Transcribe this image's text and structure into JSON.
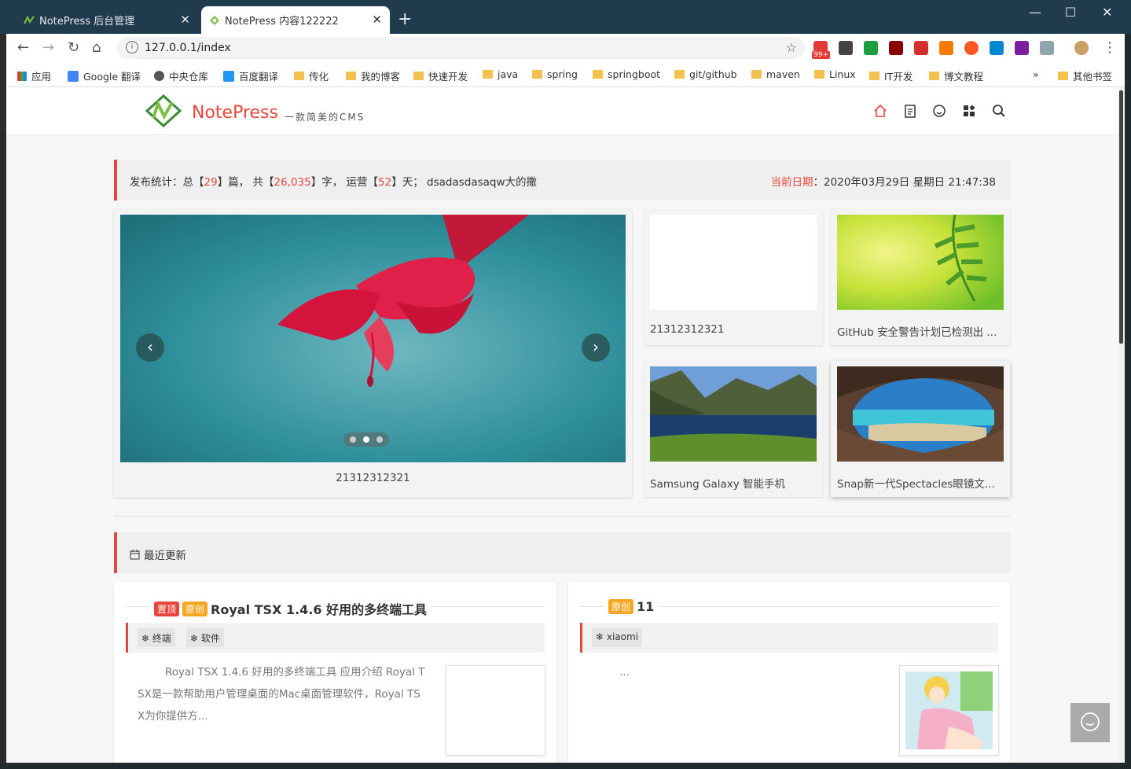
{
  "browser": {
    "tabs": [
      {
        "title": "NotePress 后台管理"
      },
      {
        "title": "NotePress 内容122222"
      }
    ],
    "url": "127.0.0.1/index",
    "ext_badge": "99+",
    "bookmarks": [
      "应用",
      "Google 翻译",
      "中央仓库",
      "百度翻译",
      "传化",
      "我的博客",
      "快速开发",
      "java",
      "spring",
      "springboot",
      "git/github",
      "maven",
      "Linux",
      "IT开发",
      "博文教程"
    ],
    "bookmarks_more": "»",
    "other_bookmarks": "其他书签"
  },
  "site": {
    "brand": "NotePress",
    "slogan": "一款简美的CMS",
    "nav_icons": [
      "home-icon",
      "notes-icon",
      "smile-icon",
      "apps-icon",
      "search-icon"
    ]
  },
  "stats": {
    "prefix": "发布统计：总【",
    "posts": "29",
    "mid1": "】篇，  共【",
    "words": "26,035",
    "mid2": "】字，  运营【",
    "days": "52",
    "suffix": "】天；  dsadasdasaqw大的撒",
    "date_label": "当前日期",
    "date_value": "：2020年03月29日 星期日 21:47:38"
  },
  "carousel": {
    "caption": "21312312321",
    "active_index": 1,
    "count": 3
  },
  "cards": [
    {
      "caption": "21312312321"
    },
    {
      "caption": "GitHub 安全警告计划已检测出 ..."
    },
    {
      "caption": "Samsung Galaxy 智能手机"
    },
    {
      "caption": "Snap新一代Spectacles眼镜文..."
    }
  ],
  "section": {
    "title": "最近更新"
  },
  "posts": [
    {
      "badges": [
        "置顶",
        "原创"
      ],
      "title": "Royal TSX 1.4.6 好用的多终端工具",
      "tags": [
        "终端",
        "软件"
      ],
      "excerpt_lines": [
        "Royal TSX 1.4.6 好用的多终端工具 应用介绍 Royal T",
        "SX是一款帮助用户管理桌面的Mac桌面管理软件，Royal TS",
        "X为你提供方..."
      ]
    },
    {
      "badges": [
        "原创"
      ],
      "title": "11",
      "tags": [
        "xiaomi"
      ],
      "excerpt_lines": [
        "..."
      ]
    }
  ],
  "colors": {
    "accent": "#e8463a",
    "badge_orange": "#f5a623"
  }
}
